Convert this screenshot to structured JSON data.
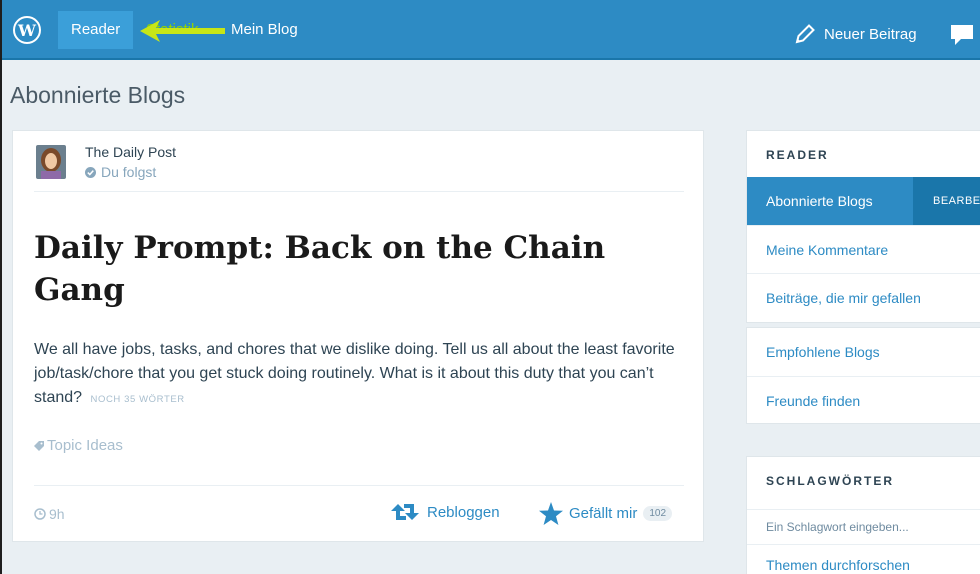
{
  "masterbar": {
    "nav": {
      "reader": "Reader",
      "stats": "Statistik",
      "my_blog": "Mein Blog"
    },
    "new_post": "Neuer Beitrag",
    "icons": {
      "logo": "wordpress-logo-icon",
      "pencil": "pencil-icon",
      "notifications": "speech-bubble-icon",
      "annotation": "arrow-icon"
    },
    "colors": {
      "bar": "#2d8bc4",
      "active_tab": "#3b9fd9",
      "annotation_arrow": "#c7e617"
    }
  },
  "page": {
    "title": "Abonnierte Blogs"
  },
  "post": {
    "blog_name": "The Daily Post",
    "follow_status": "Du folgst",
    "title": "Daily Prompt: Back on the Chain Gang",
    "excerpt": "We all have jobs, tasks, and chores that we dislike doing. Tell us all about the least favorite job/task/chore that you get stuck doing routinely. What is it about this duty that you can’t stand?",
    "more_words": "NOCH 35 WÖRTER",
    "tag": "Topic Ideas",
    "time_ago": "9h",
    "reblog_label": "Rebloggen",
    "like_label": "Gefällt mir",
    "like_count": "102"
  },
  "sidebar": {
    "reader_heading": "READER",
    "items": [
      {
        "label": "Abonnierte Blogs",
        "active": true
      },
      {
        "label": "Meine Kommentare"
      },
      {
        "label": "Beiträge, die mir gefallen"
      }
    ],
    "edit_label": "BEARBEITEN",
    "items2": [
      {
        "label": "Empfohlene Blogs"
      },
      {
        "label": "Freunde finden"
      }
    ],
    "tags_heading": "SCHLAGWÖRTER",
    "tag_input_placeholder": "Ein Schlagwort eingeben...",
    "explore_topics": "Themen durchforschen"
  }
}
